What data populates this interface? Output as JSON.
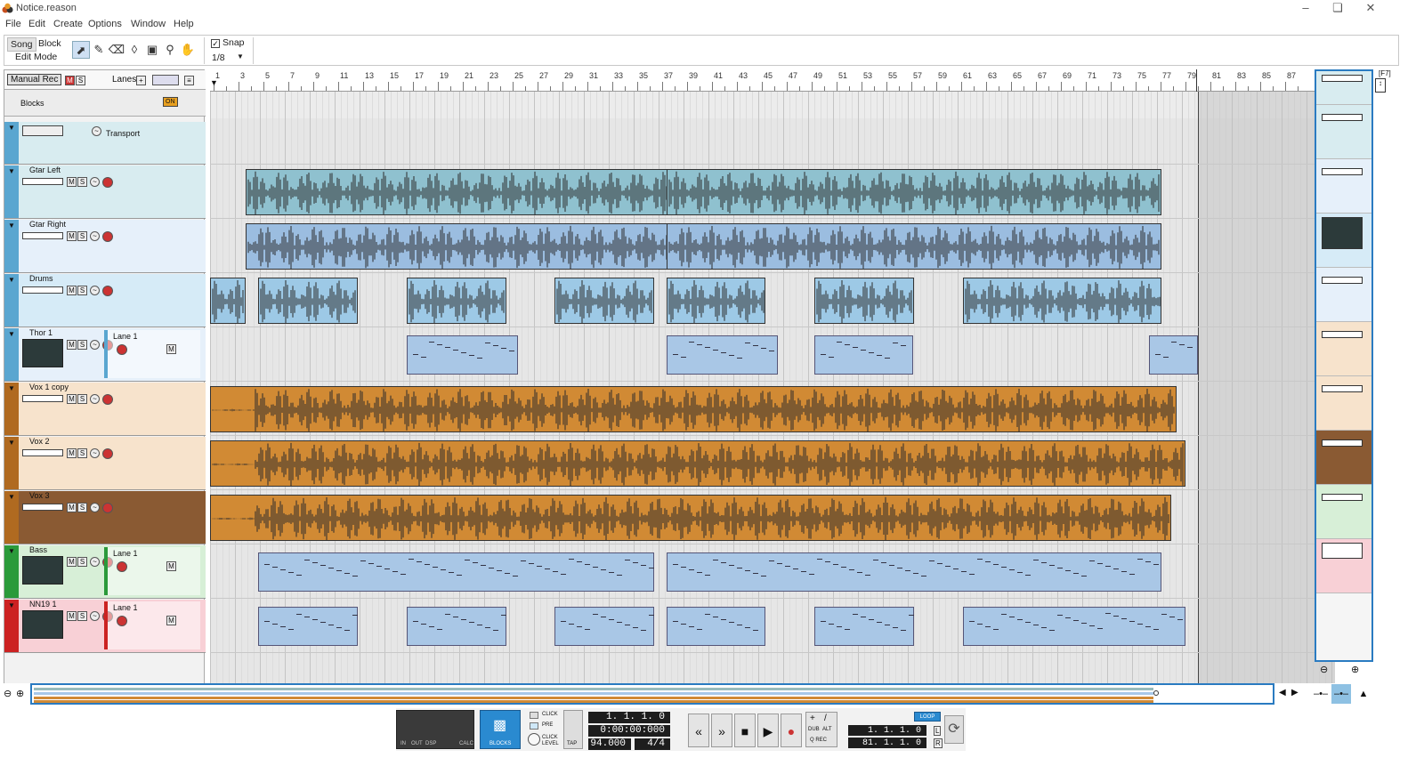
{
  "window": {
    "title": "Notice.reason"
  },
  "menu": [
    "File",
    "Edit",
    "Create",
    "Options",
    "Window",
    "Help"
  ],
  "toolbar": {
    "song": "Song",
    "block": "Block",
    "edit_mode": "Edit Mode",
    "snap_label": "Snap",
    "snap_value": "1/8",
    "snap_checked": true
  },
  "header": {
    "manual_rec": "Manual Rec",
    "lanes": "Lanes",
    "blocks": "Blocks",
    "blocks_on": "ON"
  },
  "ruler": {
    "bars": [
      "1",
      "3",
      "5",
      "7",
      "9",
      "11",
      "13",
      "15",
      "17",
      "19",
      "21",
      "23",
      "25",
      "27",
      "29",
      "31",
      "33",
      "35",
      "37",
      "39",
      "41",
      "43",
      "45",
      "47",
      "49",
      "51",
      "53",
      "55",
      "57",
      "59",
      "61",
      "63",
      "65",
      "67",
      "69",
      "71",
      "73",
      "75",
      "77",
      "79",
      "81",
      "83",
      "85",
      "87"
    ]
  },
  "tracks": [
    {
      "name": "Transport",
      "kind": "transport",
      "color": "#d8ecf0"
    },
    {
      "name": "Gtar Left",
      "kind": "audio",
      "color": "#d8ecf0",
      "clip_color": "#8fc1cf"
    },
    {
      "name": "Gtar Right",
      "kind": "audio",
      "color": "#e6f0fa",
      "clip_color": "#9bbde0"
    },
    {
      "name": "Drums",
      "kind": "audio",
      "color": "#d6ebf7",
      "clip_color": "#9dc9e6"
    },
    {
      "name": "Thor 1",
      "kind": "instrument",
      "color": "#e6f0fa",
      "lane": "Lane 1",
      "clip_color": "#a9c7e6"
    },
    {
      "name": "Vox 1 copy",
      "kind": "audio",
      "color": "#f7e3cc",
      "clip_color": "#d18a34"
    },
    {
      "name": "Vox 2",
      "kind": "audio",
      "color": "#f7e3cc",
      "clip_color": "#d18a34"
    },
    {
      "name": "Vox 3",
      "kind": "audio",
      "color": "#8a5a33",
      "clip_color": "#d18a34"
    },
    {
      "name": "Bass",
      "kind": "instrument",
      "color": "#d7efd7",
      "lane": "Lane 1",
      "clip_color": "#a9c7e6"
    },
    {
      "name": "NN19 1",
      "kind": "instrument",
      "color": "#f8d0d6",
      "lane": "Lane 1",
      "clip_color": "#a9c7e6"
    }
  ],
  "transport": {
    "in": "IN",
    "out": "OUT",
    "dsp": "DSP",
    "calc": "CALC",
    "blocks": "BLOCKS",
    "click": "CLICK",
    "pre": "PRE",
    "click_level": "CLICK LEVEL",
    "tap": "TAP",
    "position": "1.  1.  1.   0",
    "time": "0:00:00:000",
    "tempo": "94.000",
    "signature": "4/4",
    "dub": "DUB",
    "alt": "ALT",
    "q_rec": "Q REC",
    "loop": "LOOP",
    "left_locator": "1.  1.  1.   0",
    "right_locator": "81.  1.  1.   0",
    "l": "L",
    "r": "R"
  },
  "colors": {
    "accent": "#2a7bc1",
    "record": "#cc3333",
    "waveform_dark": "#2b2b2b"
  }
}
